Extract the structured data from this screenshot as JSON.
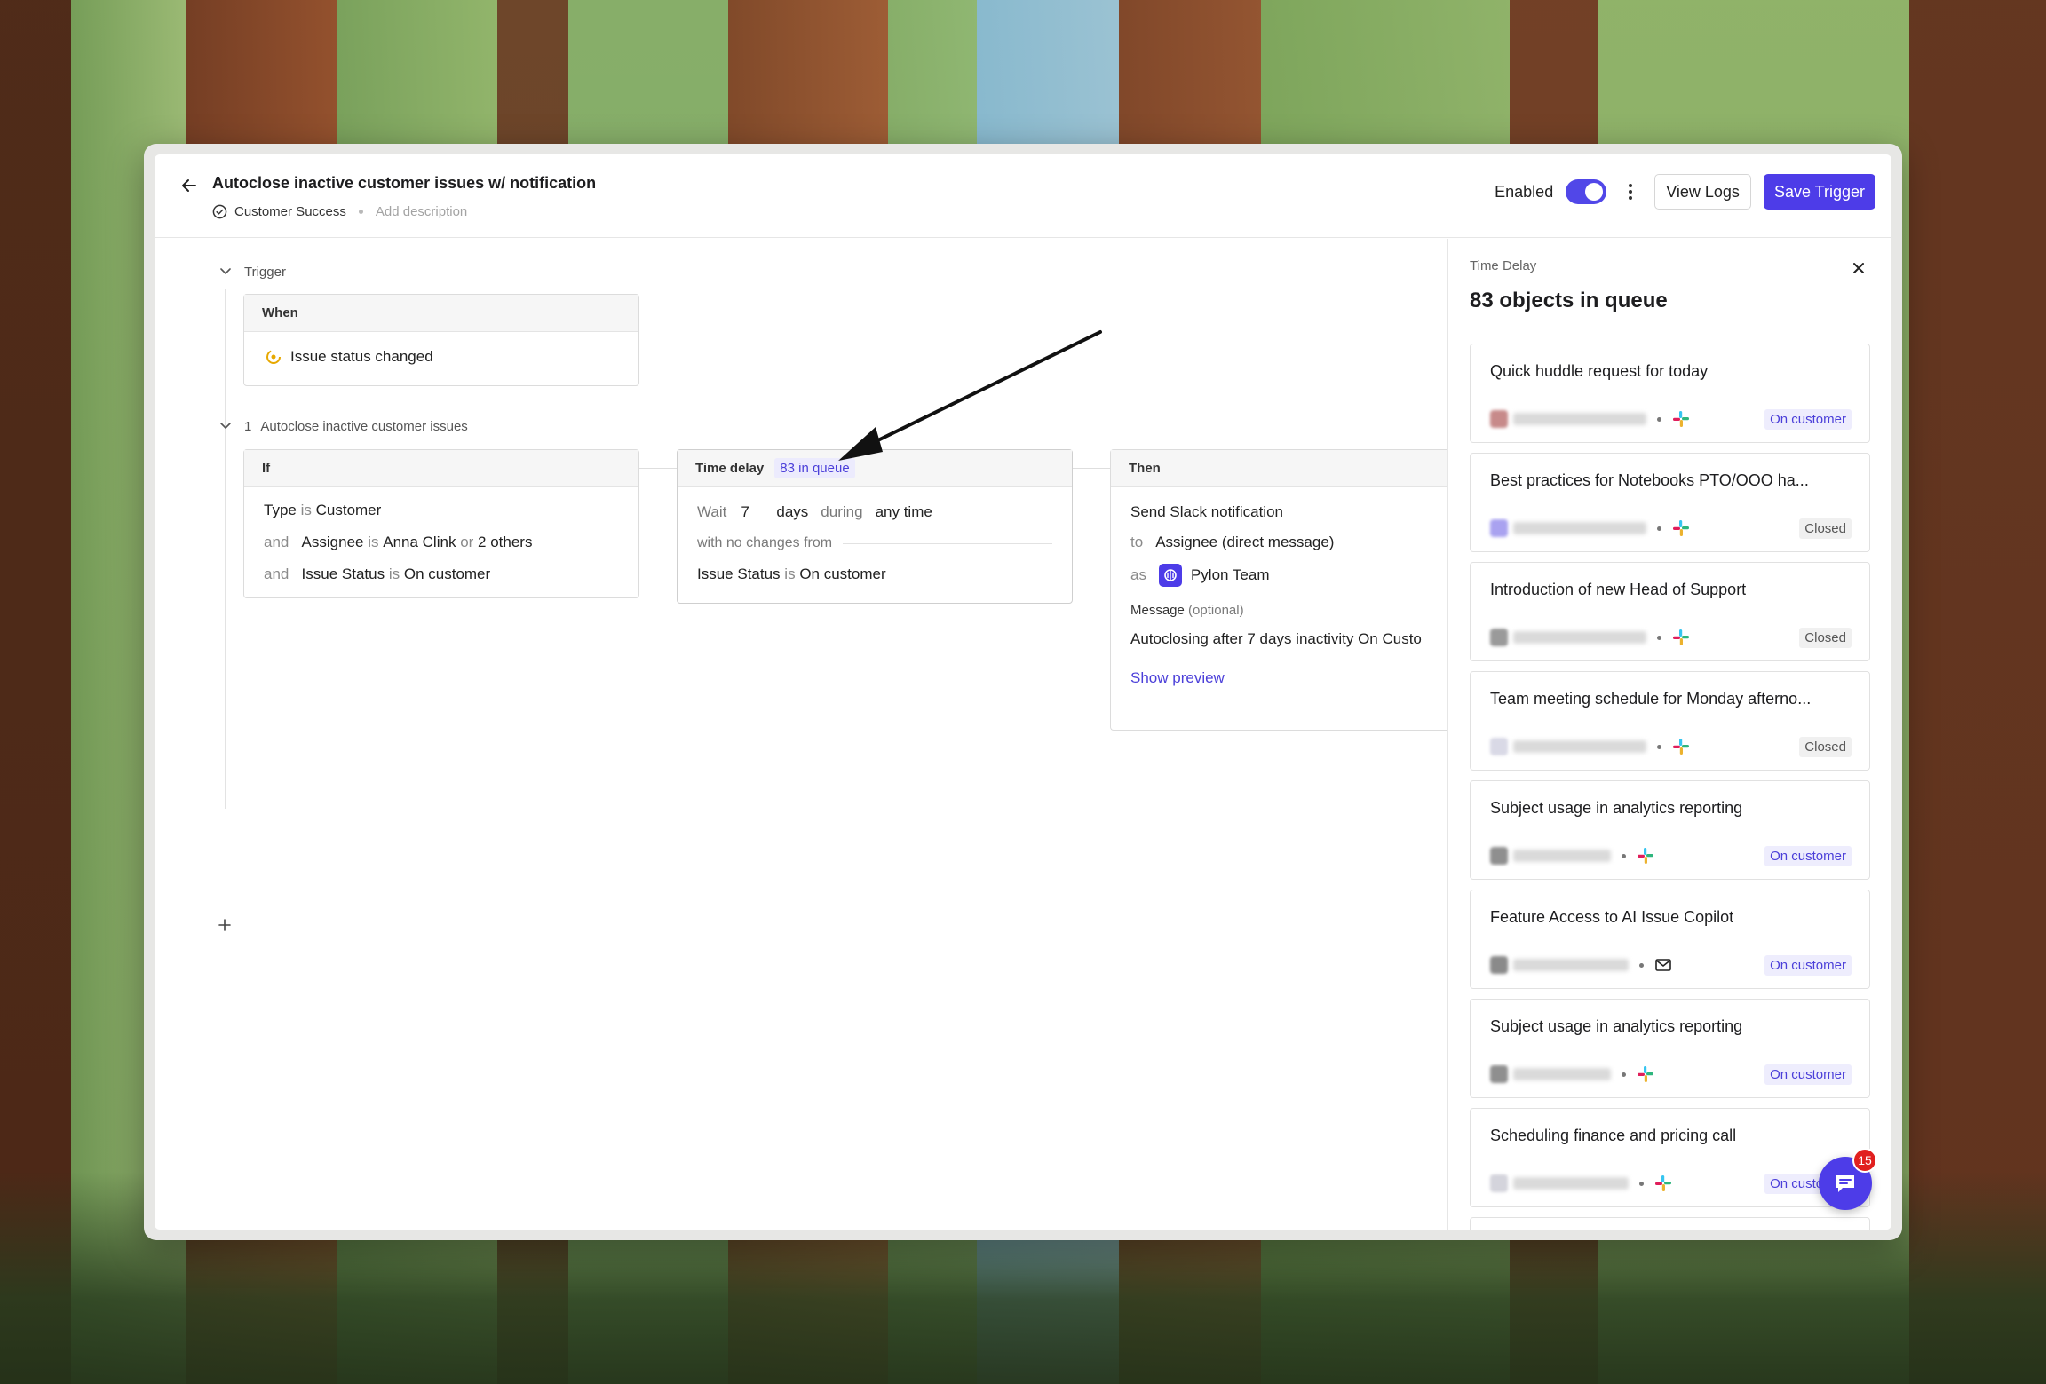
{
  "header": {
    "title": "Autoclose inactive customer issues w/ notification",
    "team": "Customer Success",
    "add_description": "Add description",
    "enabled_label": "Enabled",
    "enabled": true,
    "view_logs_label": "View Logs",
    "save_label": "Save Trigger",
    "accent_color": "#4d3ce8"
  },
  "trigger": {
    "section_label": "Trigger",
    "when_label": "When",
    "event": "Issue status changed"
  },
  "step": {
    "number": "1",
    "name": "Autoclose inactive customer issues",
    "if_card": {
      "label": "If",
      "conditions": [
        {
          "prefix": "",
          "field": "Type",
          "op": "is",
          "value": "Customer",
          "extra_op": "",
          "extra_value": ""
        },
        {
          "prefix": "and",
          "field": "Assignee",
          "op": "is",
          "value": "Anna Clink",
          "extra_op": "or",
          "extra_value": "2 others"
        },
        {
          "prefix": "and",
          "field": "Issue Status",
          "op": "is",
          "value": "On customer",
          "extra_op": "",
          "extra_value": ""
        }
      ]
    },
    "delay_card": {
      "label": "Time delay",
      "queue_badge": "83 in queue",
      "wait_label": "Wait",
      "wait_amount": "7",
      "wait_unit": "days",
      "during_label": "during",
      "during_value": "any time",
      "no_changes_label": "with no changes from",
      "field": "Issue Status",
      "op": "is",
      "value": "On customer"
    },
    "then_card": {
      "label": "Then",
      "action": "Send Slack notification",
      "to_label": "to",
      "to_value": "Assignee (direct message)",
      "as_label": "as",
      "as_value": "Pylon Team",
      "message_label": "Message",
      "message_optional": "(optional)",
      "message_value": "Autoclosing after 7 days inactivity On Custo",
      "preview_link": "Show preview"
    }
  },
  "panel": {
    "kicker": "Time Delay",
    "title": "83 objects in queue",
    "items": [
      {
        "title": "Quick huddle request for today",
        "channel": "slack-icon",
        "status": "On customer",
        "status_type": "oncustomer"
      },
      {
        "title": "Best practices for Notebooks PTO/OOO ha...",
        "channel": "slack-icon",
        "status": "Closed",
        "status_type": "closed"
      },
      {
        "title": "Introduction of new Head of Support",
        "channel": "slack-icon",
        "status": "Closed",
        "status_type": "closed"
      },
      {
        "title": "Team meeting schedule for Monday afterno...",
        "channel": "slack-icon",
        "status": "Closed",
        "status_type": "closed"
      },
      {
        "title": "Subject usage in analytics reporting",
        "channel": "slack-icon",
        "status": "On customer",
        "status_type": "oncustomer"
      },
      {
        "title": "Feature Access to AI Issue Copilot",
        "channel": "mail-icon",
        "status": "On customer",
        "status_type": "oncustomer"
      },
      {
        "title": "Subject usage in analytics reporting",
        "channel": "slack-icon",
        "status": "On customer",
        "status_type": "oncustomer"
      },
      {
        "title": "Scheduling finance and pricing call",
        "channel": "slack-icon",
        "status": "On customer",
        "status_type": "oncustomer"
      }
    ]
  },
  "chat_widget": {
    "unread_count": "15"
  }
}
